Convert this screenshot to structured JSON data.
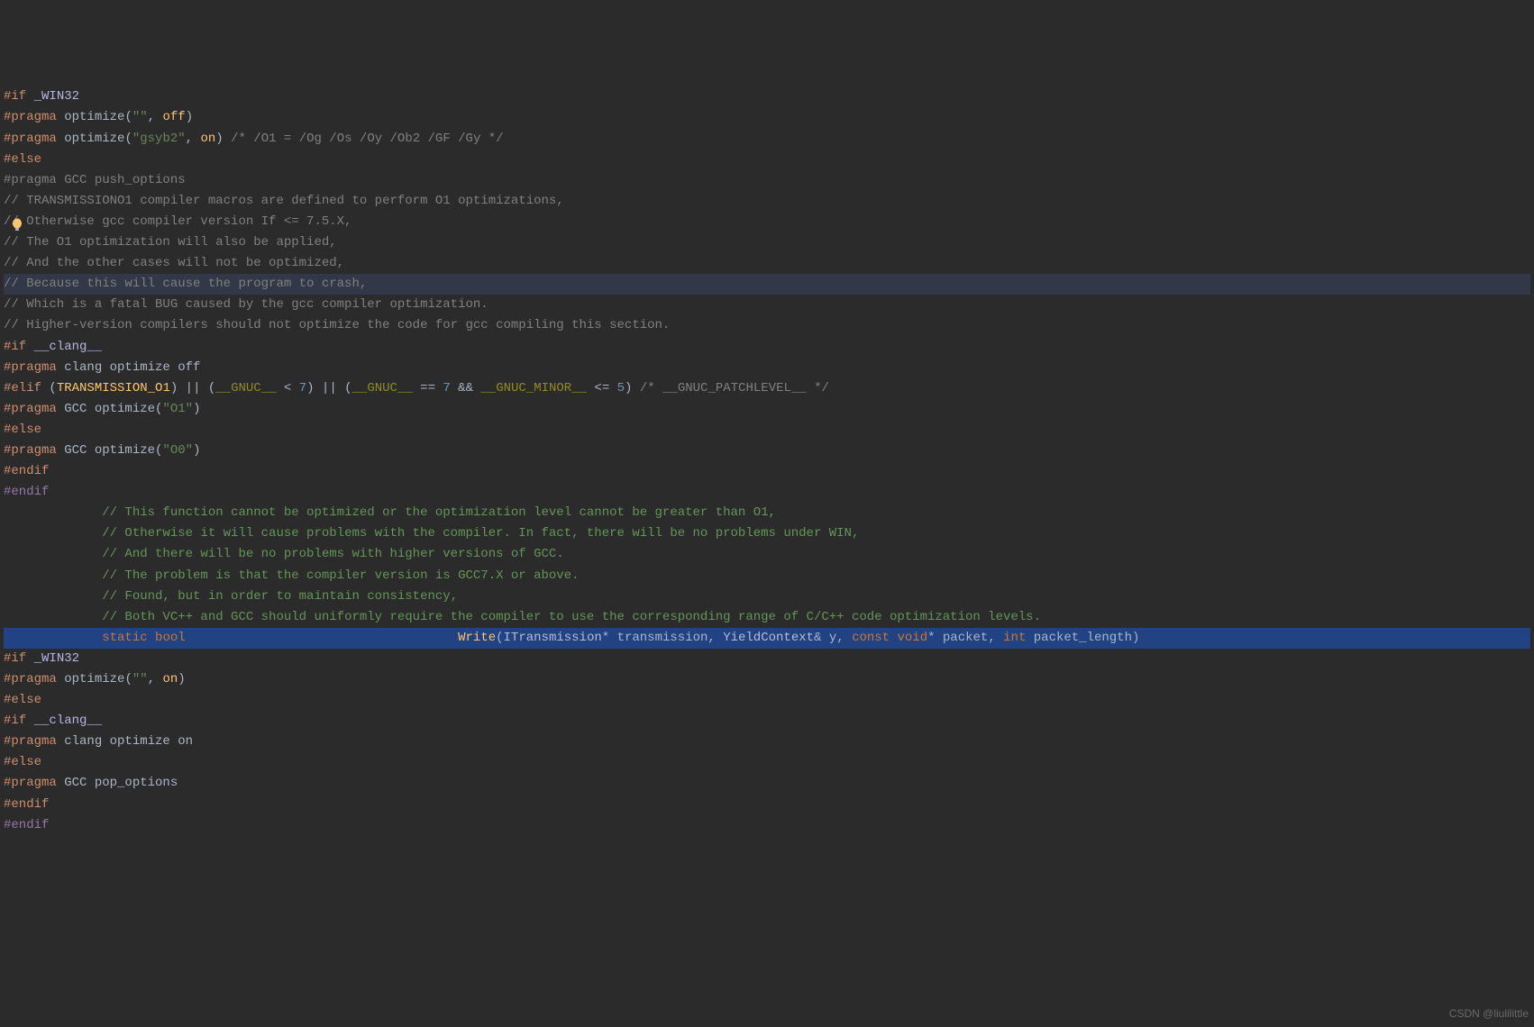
{
  "watermark": "CSDN @liulilittle",
  "lines": [
    {
      "type": "plain",
      "segs": [
        [
          "pale-purple",
          "#if"
        ],
        [
          "",
          ""
        ],
        [
          "",
          " "
        ],
        [
          "type",
          "_WIN32"
        ]
      ]
    },
    {
      "type": "plain",
      "segs": [
        [
          "pale-purple",
          "#pragma"
        ],
        [
          "",
          " "
        ],
        [
          "ident-gray",
          "optimize"
        ],
        [
          "punct",
          "("
        ],
        [
          "str",
          "\"\""
        ],
        [
          "punct",
          ", "
        ],
        [
          "kw-ident2",
          "off"
        ],
        [
          "punct",
          ")"
        ]
      ]
    },
    {
      "type": "plain",
      "segs": [
        [
          "pale-purple",
          "#pragma"
        ],
        [
          "",
          " "
        ],
        [
          "ident-gray",
          "optimize"
        ],
        [
          "punct",
          "("
        ],
        [
          "str",
          "\"gsyb2\""
        ],
        [
          "punct",
          ", "
        ],
        [
          "kw-ident2",
          "on"
        ],
        [
          "punct",
          ")"
        ],
        [
          "",
          " "
        ],
        [
          "comment",
          "/* /O1 = /Og /Os /Oy /Ob2 /GF /Gy */"
        ]
      ]
    },
    {
      "type": "plain",
      "segs": [
        [
          "pale-purple",
          "#else"
        ]
      ]
    },
    {
      "type": "plain",
      "segs": [
        [
          "comment",
          "#pragma GCC push_options"
        ]
      ]
    },
    {
      "type": "plain",
      "segs": [
        [
          "comment",
          "// TRANSMISSIONO1 compiler macros are defined to perform O1 optimizations,"
        ]
      ]
    },
    {
      "type": "plain",
      "segs": [
        [
          "comment",
          "// Otherwise gcc compiler version If <= 7.5.X,"
        ]
      ]
    },
    {
      "type": "plain",
      "segs": [
        [
          "comment",
          "// The O1 optimization will also be applied,"
        ]
      ]
    },
    {
      "type": "plain",
      "segs": [
        [
          "comment",
          "// And the other cases will not be optimized,"
        ]
      ]
    },
    {
      "type": "highlight",
      "segs": [
        [
          "comment",
          "// Because this will cause the program to crash,"
        ]
      ]
    },
    {
      "type": "plain",
      "segs": [
        [
          "comment",
          "// Which is a fatal BUG caused by the gcc compiler optimization."
        ]
      ]
    },
    {
      "type": "plain",
      "segs": [
        [
          "comment",
          "// Higher-version compilers should not optimize the code for gcc compiling this section."
        ]
      ]
    },
    {
      "type": "plain",
      "segs": [
        [
          "pale-purple",
          "#if"
        ],
        [
          "",
          " "
        ],
        [
          "type",
          "__clang__"
        ]
      ]
    },
    {
      "type": "plain",
      "segs": [
        [
          "pale-purple",
          "#pragma"
        ],
        [
          "",
          " "
        ],
        [
          "ident-gray",
          "clang optimize off"
        ]
      ]
    },
    {
      "type": "plain",
      "segs": [
        [
          "pale-purple",
          "#elif"
        ],
        [
          "",
          " "
        ],
        [
          "punct",
          "("
        ],
        [
          "kw-ident2",
          "TRANSMISSION_O1"
        ],
        [
          "punct",
          ") || ("
        ],
        [
          "macro",
          "__GNUC__"
        ],
        [
          "punct",
          " < "
        ],
        [
          "num",
          "7"
        ],
        [
          "punct",
          ") || ("
        ],
        [
          "macro",
          "__GNUC__"
        ],
        [
          "punct",
          " == "
        ],
        [
          "num",
          "7"
        ],
        [
          "punct",
          " && "
        ],
        [
          "macro",
          "__GNUC_MINOR__"
        ],
        [
          "punct",
          " <= "
        ],
        [
          "num",
          "5"
        ],
        [
          "punct",
          ")"
        ],
        [
          "",
          " "
        ],
        [
          "comment",
          "/* __GNUC_PATCHLEVEL__ */"
        ]
      ]
    },
    {
      "type": "plain",
      "segs": [
        [
          "pale-purple",
          "#pragma"
        ],
        [
          "",
          " "
        ],
        [
          "ident-gray",
          "GCC optimize"
        ],
        [
          "punct",
          "("
        ],
        [
          "str",
          "\"O1\""
        ],
        [
          "punct",
          ")"
        ]
      ]
    },
    {
      "type": "plain",
      "segs": [
        [
          "pale-purple",
          "#else"
        ]
      ]
    },
    {
      "type": "plain",
      "segs": [
        [
          "pale-purple",
          "#pragma"
        ],
        [
          "",
          " "
        ],
        [
          "ident-gray",
          "GCC optimize"
        ],
        [
          "punct",
          "("
        ],
        [
          "str",
          "\"O0\""
        ],
        [
          "punct",
          ")"
        ]
      ]
    },
    {
      "type": "plain",
      "segs": [
        [
          "pale-purple",
          "#endif"
        ]
      ]
    },
    {
      "type": "plain",
      "segs": [
        [
          "kw-ident",
          "#endif"
        ]
      ]
    },
    {
      "type": "indent",
      "segs": [
        [
          "comment-green",
          "// This function cannot be optimized or the optimization level cannot be greater than O1,"
        ]
      ]
    },
    {
      "type": "indent",
      "segs": [
        [
          "comment-green",
          "// Otherwise it will cause problems with the compiler. In fact, there will be no problems under WIN,"
        ]
      ]
    },
    {
      "type": "indent",
      "segs": [
        [
          "comment-green",
          "// And there will be no problems with higher versions of GCC."
        ]
      ]
    },
    {
      "type": "indent",
      "segs": [
        [
          "comment-green",
          "// The problem is that the compiler version is GCC7.X or above."
        ]
      ]
    },
    {
      "type": "indent",
      "segs": [
        [
          "comment-green",
          "// Found, but in order to maintain consistency,"
        ]
      ]
    },
    {
      "type": "indent",
      "segs": [
        [
          "comment-green",
          "// Both VC++ and GCC should uniformly require the compiler to use the corresponding range of C/C++ code optimization levels."
        ]
      ]
    },
    {
      "type": "cursor-indent",
      "segs": [
        [
          "kw-static",
          "static"
        ],
        [
          "",
          " "
        ],
        [
          "kw-bool",
          "bool"
        ],
        [
          "",
          "                                    "
        ],
        [
          "fn-name",
          "Write"
        ],
        [
          "punct",
          "("
        ],
        [
          "classname",
          "ITransmission"
        ],
        [
          "punct",
          "* "
        ],
        [
          "ident-gray",
          "transmission"
        ],
        [
          "punct",
          ", "
        ],
        [
          "classname",
          "YieldContext"
        ],
        [
          "punct",
          "& "
        ],
        [
          "ident-gray",
          "y"
        ],
        [
          "punct",
          ", "
        ],
        [
          "kw-static",
          "const"
        ],
        [
          "",
          " "
        ],
        [
          "kw-bool",
          "void"
        ],
        [
          "punct",
          "* "
        ],
        [
          "ident-gray",
          "packet"
        ],
        [
          "punct",
          ", "
        ],
        [
          "kw-bool",
          "int"
        ],
        [
          "",
          " "
        ],
        [
          "ident-gray",
          "packet_length"
        ],
        [
          "punct",
          ")"
        ]
      ]
    },
    {
      "type": "plain",
      "segs": [
        [
          "pale-purple",
          "#if"
        ],
        [
          "",
          " "
        ],
        [
          "type",
          "_WIN32"
        ]
      ]
    },
    {
      "type": "plain",
      "segs": [
        [
          "pale-purple",
          "#pragma"
        ],
        [
          "",
          " "
        ],
        [
          "ident-gray",
          "optimize"
        ],
        [
          "punct",
          "("
        ],
        [
          "str",
          "\"\""
        ],
        [
          "punct",
          ", "
        ],
        [
          "kw-ident2",
          "on"
        ],
        [
          "punct",
          ")"
        ]
      ]
    },
    {
      "type": "plain",
      "segs": [
        [
          "pale-purple",
          "#else"
        ]
      ]
    },
    {
      "type": "plain",
      "segs": [
        [
          "pale-purple",
          "#if"
        ],
        [
          "",
          " "
        ],
        [
          "type",
          "__clang__"
        ]
      ]
    },
    {
      "type": "plain",
      "segs": [
        [
          "pale-purple",
          "#pragma"
        ],
        [
          "",
          " "
        ],
        [
          "ident-gray",
          "clang optimize on"
        ]
      ]
    },
    {
      "type": "plain",
      "segs": [
        [
          "pale-purple",
          "#else"
        ]
      ]
    },
    {
      "type": "plain",
      "segs": [
        [
          "pale-purple",
          "#pragma"
        ],
        [
          "",
          " "
        ],
        [
          "ident-gray",
          "GCC pop_options"
        ]
      ]
    },
    {
      "type": "plain",
      "segs": [
        [
          "pale-purple",
          "#endif"
        ]
      ]
    },
    {
      "type": "plain",
      "segs": [
        [
          "kw-ident",
          "#endif"
        ]
      ]
    }
  ]
}
